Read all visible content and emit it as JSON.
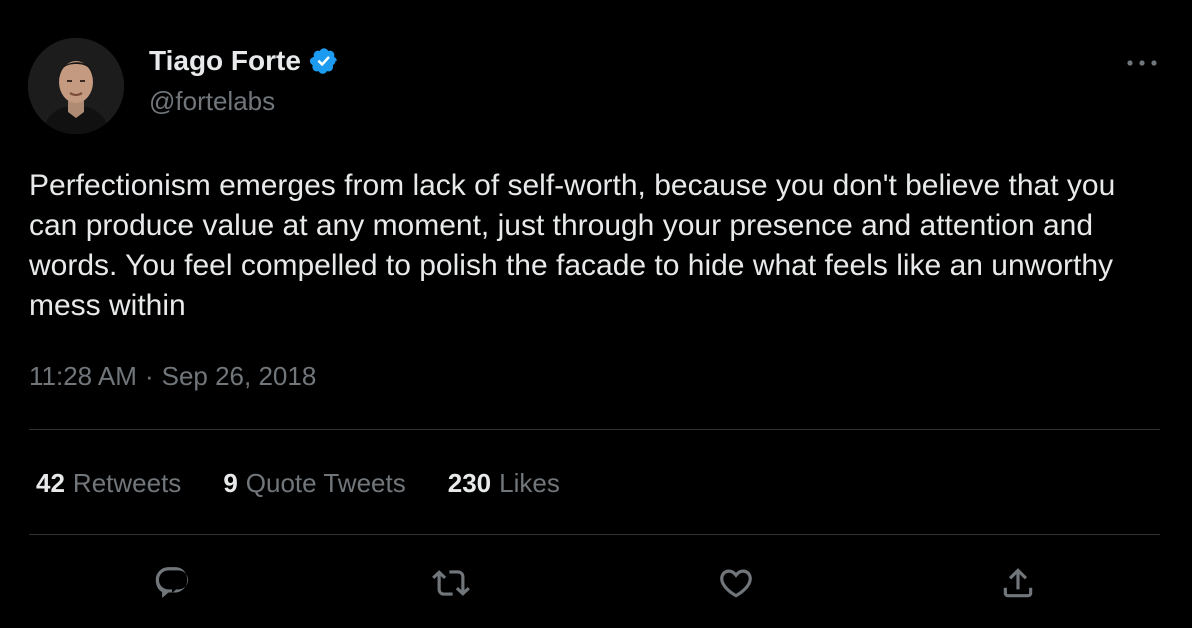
{
  "author": {
    "name": "Tiago Forte",
    "handle": "@fortelabs",
    "verified_icon": "verified-badge-icon",
    "avatar_icon": "profile-avatar"
  },
  "tweet": {
    "text": "Perfectionism emerges from lack of self-worth, because you don't believe that you can produce value at any moment, just through your presence and attention and words. You feel compelled to polish the facade to hide what feels like an unworthy mess within",
    "time": "11:28 AM",
    "separator": "·",
    "date": "Sep 26, 2018"
  },
  "stats": [
    {
      "count": "42",
      "label": "Retweets"
    },
    {
      "count": "9",
      "label": "Quote Tweets"
    },
    {
      "count": "230",
      "label": "Likes"
    }
  ],
  "actions": [
    "reply-icon",
    "retweet-icon",
    "like-icon",
    "share-icon"
  ],
  "colors": {
    "background": "#000000",
    "primary_text": "#e7e9ea",
    "secondary_text": "#71767b",
    "divider": "#2f3336",
    "verified": "#1d9bf0"
  }
}
